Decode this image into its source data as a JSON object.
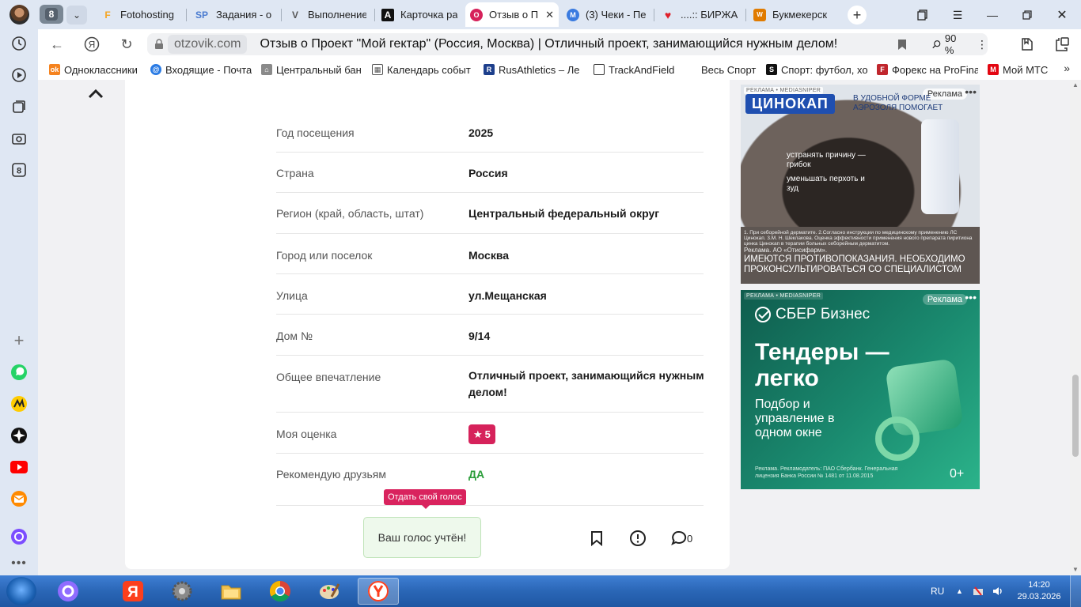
{
  "tabs": {
    "counter": "8",
    "items": [
      {
        "title": "Fotohosting",
        "icon": "F",
        "icon_color": "#f5a623"
      },
      {
        "title": "Задания - of",
        "icon": "SP",
        "icon_color": "#4a7bd0"
      },
      {
        "title": "Выполнение",
        "icon": "V",
        "icon_color": "#555555"
      },
      {
        "title": "Карточка ра",
        "icon": "A",
        "icon_color": "#111111"
      },
      {
        "title": "Отзыв о П",
        "icon": "O",
        "icon_color": "#d6225b"
      },
      {
        "title": "(3) Чеки - Пе",
        "icon": "M",
        "icon_color": "#3a7be0"
      },
      {
        "title": "....:: БИРЖА",
        "icon": "♥",
        "icon_color": "#e0202a"
      },
      {
        "title": "Букмекерск",
        "icon": "W",
        "icon_color": "#e07b00"
      }
    ]
  },
  "address": {
    "domain": "otzovik.com",
    "title": "Отзыв о Проект \"Мой гектар\" (Россия, Москва) | Отличный проект, занимающийся нужным делом!",
    "zoom": "90 %"
  },
  "bookmarks": [
    {
      "label": "Одноклассники",
      "color": "#f5831f",
      "glyph": "ok"
    },
    {
      "label": "Входящие - Почта",
      "color": "#2a7be4",
      "glyph": "@"
    },
    {
      "label": "Центральный бан",
      "color": "#777777",
      "glyph": "⌘"
    },
    {
      "label": "Календарь событ",
      "color": "#555555",
      "glyph": "▦"
    },
    {
      "label": "RusAthletics – Ле",
      "color": "#1d3f8c",
      "glyph": "R"
    },
    {
      "label": "TrackAndField",
      "color": "#ffffff",
      "glyph": ""
    },
    {
      "label": "Весь Спорт",
      "color": "",
      "glyph": ""
    },
    {
      "label": "Спорт: футбол, хо",
      "color": "#111111",
      "glyph": "S"
    },
    {
      "label": "Форекс на ProFina",
      "color": "#c0262d",
      "glyph": "F"
    },
    {
      "label": "Мой МТС",
      "color": "#e30611",
      "glyph": "M"
    }
  ],
  "review": {
    "rows": [
      {
        "label": "Год посещения",
        "value": "2025"
      },
      {
        "label": "Страна",
        "value": "Россия"
      },
      {
        "label": "Регион (край, область, штат)",
        "value": "Центральный федеральный округ"
      },
      {
        "label": "Город или поселок",
        "value": "Москва"
      },
      {
        "label": "Улица",
        "value": "ул.Мещанская"
      },
      {
        "label": "Дом №",
        "value": "9/14"
      },
      {
        "label": "Общее впечатление",
        "value": "Отличный проект, занимающийся нужным делом!"
      },
      {
        "label": "Моя оценка",
        "value": "5"
      },
      {
        "label": "Рекомендую друзьям",
        "value": "ДА"
      }
    ],
    "tooltip": "Отдать свой голос",
    "vote_text": "Ваш голос учтён!",
    "comments_count": "0"
  },
  "ads": [
    {
      "label": "РЕКЛАМА • MEDIASNIPER",
      "tag": "Реклама",
      "brand": "ЦИНОКАП",
      "headline": "В УДОБНОЙ ФОРМЕ АЭРОЗОЛЯ ПОМОГАЕТ",
      "bullet1": "устранять причину — грибок",
      "bullet2": "уменьшать перхоть и зуд",
      "fine": "1. При себорейной дерматите. 2.Согласно инструкции по медицинскому применению ЛС Цинокап. 3.М. Н. Шеклакова. Оценка эффективности применения нового препарата пиритиона цинка Цинокап в терапии больных себорейным дерматитом.",
      "advertiser": "Реклама. АО «Отисифарм».",
      "warning": "ИМЕЮТСЯ ПРОТИВОПОКАЗАНИЯ. НЕОБХОДИМО ПРОКОНСУЛЬТИРОВАТЬСЯ СО СПЕЦИАЛИСТОМ"
    },
    {
      "label": "РЕКЛАМА • MEDIASNIPER",
      "tag": "Реклама",
      "brand": "СБЕР Бизнес",
      "headline": "Тендеры — легко",
      "sub": "Подбор и управление в одном окне",
      "fine": "Реклама. Рекламодатель: ПАО Сбербанк. Генеральная лицензия Банка России № 1481 от 11.08.2015",
      "age": "0+"
    }
  ],
  "taskbar": {
    "lang": "RU",
    "time": "14:20",
    "date": "29.03.2026"
  }
}
